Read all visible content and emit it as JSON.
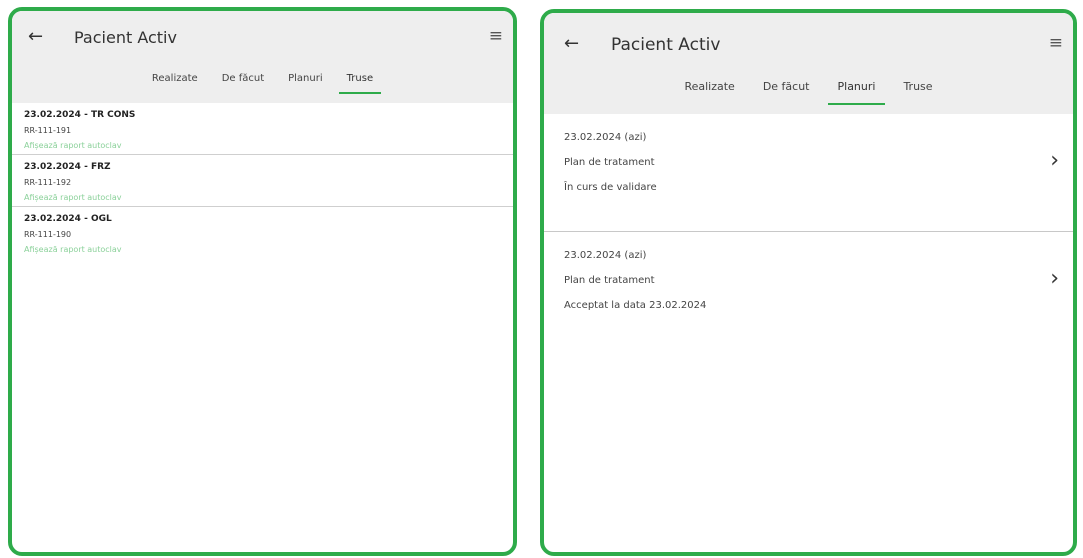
{
  "accent_color": "#2eab4a",
  "left": {
    "title": "Pacient Activ",
    "tabs": [
      "Realizate",
      "De făcut",
      "Planuri",
      "Truse"
    ],
    "active_tab": "Truse",
    "kits": [
      {
        "title": "23.02.2024 - TR CONS",
        "code": "RR-111-191",
        "link": "Afișează raport autoclav"
      },
      {
        "title": "23.02.2024 - FRZ",
        "code": "RR-111-192",
        "link": "Afișează raport autoclav"
      },
      {
        "title": "23.02.2024 - OGL",
        "code": "RR-111-190",
        "link": "Afișează raport autoclav"
      }
    ]
  },
  "right": {
    "title": "Pacient Activ",
    "tabs": [
      "Realizate",
      "De făcut",
      "Planuri",
      "Truse"
    ],
    "active_tab": "Planuri",
    "plans": [
      {
        "date": "23.02.2024 (azi)",
        "name": "Plan de tratament",
        "status": "În curs de validare"
      },
      {
        "date": "23.02.2024 (azi)",
        "name": "Plan de tratament",
        "status": "Acceptat la data  23.02.2024"
      }
    ]
  },
  "icons": {
    "back": "arrow-left-icon",
    "menu": "hamburger-menu-icon",
    "chevron": "chevron-right-icon"
  }
}
